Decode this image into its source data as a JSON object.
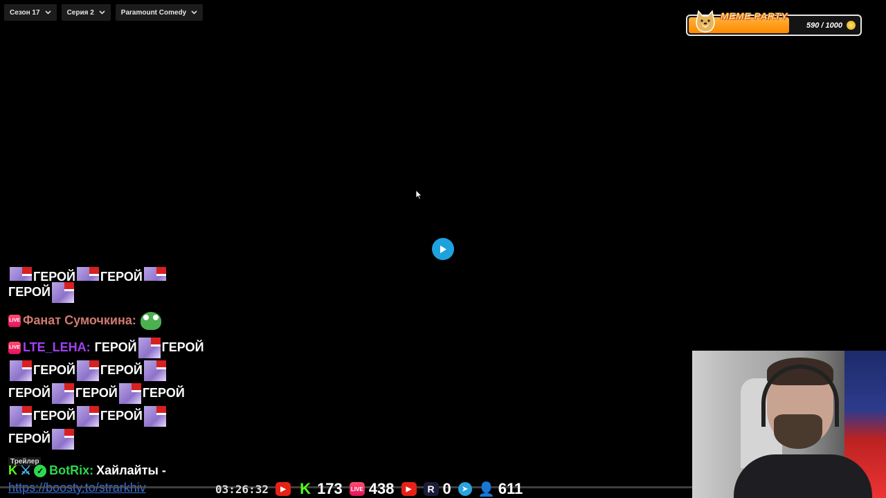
{
  "topbar": {
    "season": "Сезон 17",
    "episode": "Серия 2",
    "channel": "Paramount Comedy"
  },
  "meme_party": {
    "title": "MEME PARTY",
    "count": "590 / 1000",
    "progress": 0.59
  },
  "chat": {
    "hero_word": "ГЕРОЙ",
    "live_badge": "LIVE",
    "msg_fan_user": "Фанат Сумочкина:",
    "msg_lte_user": "LTE_LEHA:",
    "trailer_label": "Трейлер",
    "bot_user": "BotRix:",
    "bot_text": "Хайлайты -",
    "bot_link": "https://boosty.to/strarkhiv"
  },
  "stats": {
    "timer": "03:26:32",
    "kick_count": "173",
    "vk_live_count": "438",
    "rutube_count": "0",
    "viewers_count": "611"
  },
  "colors": {
    "play_button": "#1ea2df",
    "kick_green": "#53fc18",
    "youtube_red": "#e62117",
    "bot_name": "#2bd94c"
  }
}
